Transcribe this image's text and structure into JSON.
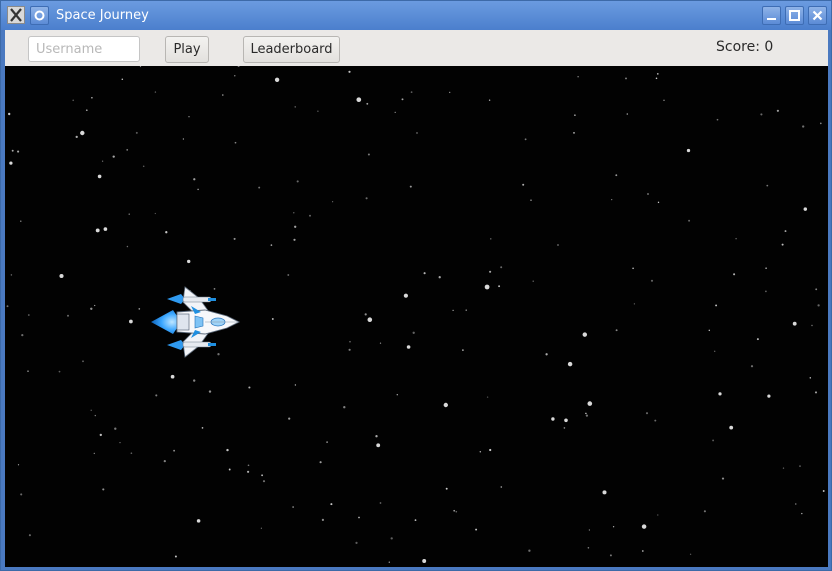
{
  "window": {
    "title": "Space Journey",
    "app_icon": "x-icon",
    "menu_icon": "circle-menu-icon",
    "controls": [
      "minimize-icon",
      "maximize-icon",
      "close-icon"
    ]
  },
  "toolbar": {
    "username_placeholder": "Username",
    "username_value": "",
    "play_label": "Play",
    "leaderboard_label": "Leaderboard",
    "score_text": "Score: 0"
  },
  "game": {
    "background_color": "#020202",
    "player_ship": "spaceship-sprite",
    "ship_colors": {
      "hull": "#f2f4f8",
      "accent": "#1f8fe0",
      "flame": "#3aa6ff"
    }
  }
}
